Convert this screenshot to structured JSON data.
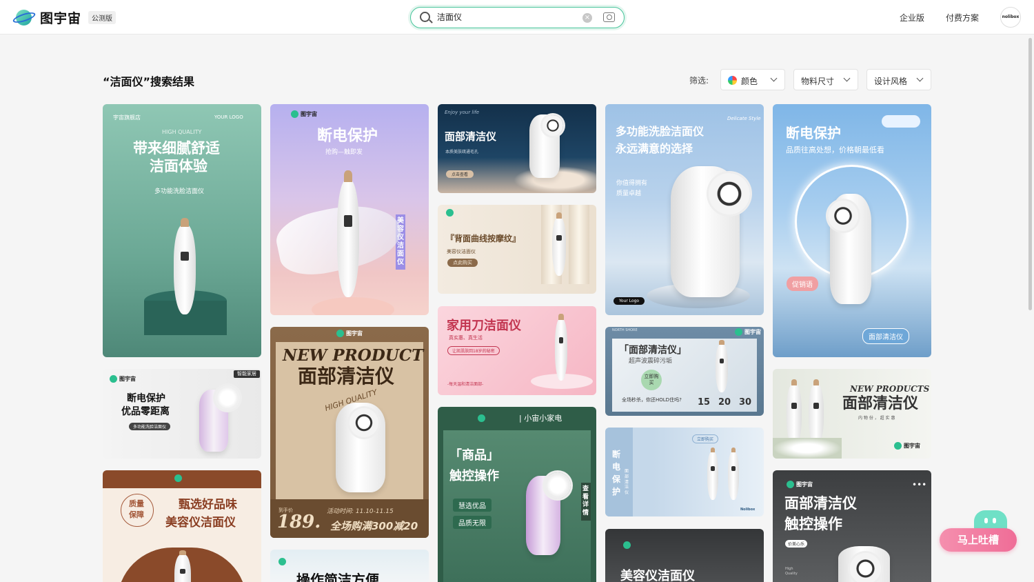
{
  "header": {
    "logo_text": "图宇宙",
    "beta_badge": "公测版",
    "search_value": "洁面仪",
    "nav": [
      "企业版",
      "付费方案"
    ],
    "avatar_text": "nolibox"
  },
  "results": {
    "title": "“洁面仪”搜索结果",
    "filter_label": "筛选:",
    "filters": [
      "颜色",
      "物料尺寸",
      "设计风格"
    ]
  },
  "cards": {
    "c1": {
      "shop": "宇宙旗舰店",
      "logo": "YOUR LOGO",
      "eyebrow": "HIGH QUALITY",
      "title1": "带来细腻舒适",
      "title2": "洁面体验",
      "sub": "多功能洗脸洁面仪"
    },
    "c2": {
      "brand": "图宇宙",
      "title": "断电保护",
      "sub": "抢购—触即发",
      "side": "美容仪洁面仪"
    },
    "c3": {
      "eyebrow": "Enjoy your life",
      "title": "面部清洁仪",
      "sub": "本质美肤疏通毛孔",
      "btn": "点击查看"
    },
    "c4": {
      "title": "『背面曲线按摩纹』",
      "sub": "美容仪洁面仪",
      "btn": "点此购买"
    },
    "c5": {
      "title": "家用刀洁面仪",
      "sub": "真实惠、真生活",
      "pill": "让凯肌肤回18岁的秘密",
      "foot": "-每天温和清洁面部-"
    },
    "c6": {
      "brand": "图宇宙",
      "tag": "智能家居",
      "title1": "断电保护",
      "title2": "优品零距离",
      "pill": "多功能洗脸洁面仪"
    },
    "c7": {
      "brand": "图宇宙",
      "title1": "NEW PRODUCT",
      "title2": "面部清洁仪",
      "script": "HIGH QUALITY",
      "price_label": "到手价",
      "price": "189.",
      "time": "活动时间: 11.10-11.15",
      "promo": "全场购满300减20"
    },
    "c8": {
      "store": "| 小宙小家电",
      "title1": "「商品」",
      "title2": "触控操作",
      "pill1": "慧选优品",
      "pill2": "品质无限",
      "side": "查看详情"
    },
    "c9": {
      "script": "Delicate Style",
      "title1": "多功能洗脸洁面仪",
      "title2": "永远满意的选择",
      "sub1": "你值得拥有",
      "sub2": "质量卓越",
      "logo": "Your Logo"
    },
    "c10": {
      "brand": "图宇宙",
      "corner": "NORTH SHORE",
      "title": "「面部清洁仪」",
      "sub": "超声波震碎污垢",
      "badge": "立即购买",
      "line": "全场秒杀，你还HOLD住吗?",
      "n1": "15",
      "n2": "20",
      "n3": "30"
    },
    "c11": {
      "side": "断电保护",
      "side2": "面部清洁仪",
      "pill": "立即购买",
      "brand": "Nolibox"
    },
    "c12": {
      "title": "美容仪洁面仪"
    },
    "c13": {
      "title": "断电保护",
      "sub": "品质往高处想，价格朝最低看",
      "tag": "促销语",
      "pill": "面部清洁仪"
    },
    "c14": {
      "title1": "NEW PRODUCTS",
      "title2": "面部清洁仪",
      "sub": "内 物 份 ， 超 实 惠",
      "brand": "图宇宙"
    },
    "c15": {
      "brand": "图宇宙",
      "title1": "面部清洁仪",
      "title2": "触控操作",
      "pill": "价美心乐",
      "foot": "High Quality"
    },
    "c16": {
      "brand": "图宇宙",
      "title1": "质量",
      "title2": "保障",
      "t1": "甄选好品味",
      "t2": "美容仪洁面仪"
    },
    "c17": {
      "title": "操作简洁方便"
    }
  },
  "feedback": {
    "label": "马上吐槽"
  }
}
